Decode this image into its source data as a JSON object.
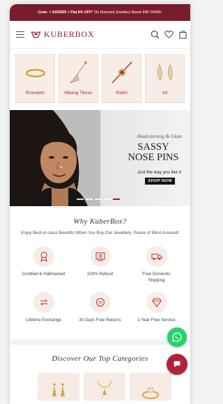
{
  "promo": {
    "code_text": "Code: < SAVER6 > Flat 8% OFF*",
    "offer_text": "On Diamond Jewellery Above INR 24999/-"
  },
  "header": {
    "logo_text": "KUBERBOX",
    "icons": [
      "menu-icon",
      "search-icon",
      "heart-icon",
      "bag-icon"
    ]
  },
  "categories": [
    {
      "label": "Bracelets",
      "icon": "bracelet-icon"
    },
    {
      "label": "Maang Tikkas",
      "icon": "maang-tikka-icon"
    },
    {
      "label": "Rakhi",
      "icon": "rakhi-icon"
    },
    {
      "label": "All",
      "icon": "earrings-icon"
    }
  ],
  "banner": {
    "subtitle": "Head-turning & Glam",
    "title_line1": "SASSY",
    "title_line2": "NOSE PINS",
    "tagline": "Just the way you like it",
    "button": "SHOP NOW",
    "slides": 5,
    "active_slide": 5
  },
  "why": {
    "title": "Why KuberBox?",
    "subtitle": "Enjoy Best-in-class Benefits When You Buy Our Jewellery. Peace of Mind Assured!"
  },
  "benefits": [
    {
      "label": "Certified & Hallmarked",
      "icon": "certified-icon"
    },
    {
      "label": "100% Refund",
      "icon": "refund-icon"
    },
    {
      "label": "Free Domestic Shipping",
      "icon": "shipping-icon"
    },
    {
      "label": "Lifetime Exchange",
      "icon": "exchange-icon"
    },
    {
      "label": "30 Days Free Returns",
      "icon": "returns-icon"
    },
    {
      "label": "1 Year Free Service",
      "icon": "service-icon"
    }
  ],
  "discover": {
    "title": "Discover Our Top Categories"
  },
  "floating": {
    "whatsapp_icon": "whatsapp-icon",
    "chat_icon": "chat-icon"
  },
  "colors": {
    "brand": "#8a2035",
    "promo_bg": "#7a1c2e",
    "tile_bg": "#f7ece6",
    "whatsapp": "#25d366",
    "chat": "#b0233a"
  }
}
